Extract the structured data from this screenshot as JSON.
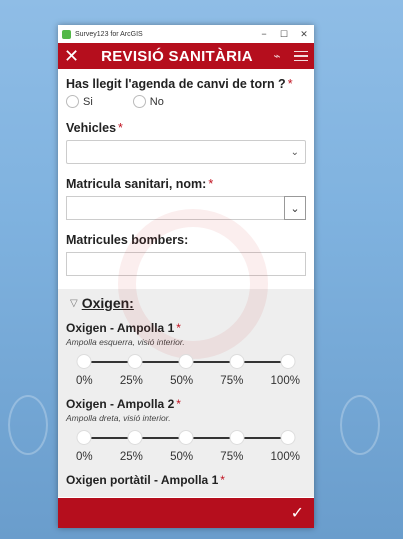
{
  "window": {
    "title": "Survey123 for ArcGIS",
    "minimize": "−",
    "maximize": "☐",
    "close": "✕"
  },
  "header": {
    "close_glyph": "✕",
    "title": "REVISIÓ SANITÀRIA",
    "satellite_glyph": "⌁"
  },
  "form": {
    "q1": {
      "label": "Has llegit l'agenda de canvi de torn ?",
      "required": "*",
      "options": [
        "Si",
        "No"
      ]
    },
    "q2": {
      "label": "Vehicles",
      "required": "*",
      "chevron": "⌄"
    },
    "q3": {
      "label": "Matricula sanitari, nom:",
      "required": "*",
      "chevron": "⌄"
    },
    "q4": {
      "label": "Matricules bombers:"
    },
    "group": {
      "title": "Oxigen:",
      "toggle_glyph": "▽",
      "q1": {
        "label": "Oxigen - Ampolla 1",
        "required": "*",
        "hint": "Ampolla esquerra, visió interior."
      },
      "q2": {
        "label": "Oxigen - Ampolla 2",
        "required": "*",
        "hint": "Ampolla dreta, visió interior."
      },
      "q3": {
        "label": "Oxigen portàtil - Ampolla 1",
        "required": "*"
      },
      "ticks": [
        "0%",
        "25%",
        "50%",
        "75%",
        "100%"
      ]
    }
  },
  "footer": {
    "submit_glyph": "✓"
  },
  "colors": {
    "brand": "#b50e1d",
    "group_bg": "#eeeeee"
  }
}
